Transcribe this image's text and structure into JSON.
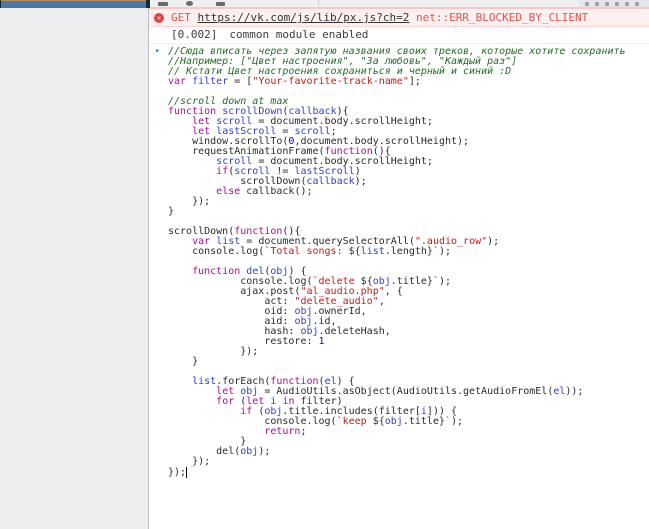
{
  "colors": {
    "vk_brand_blue": "#4a76a8",
    "error_red": "#e25252",
    "error_bg": "#fff0f0",
    "keyword_magenta": "#aa0d91",
    "variable_blue": "#3341c4",
    "string_red": "#c41a16",
    "comment_green": "#236e25",
    "input_chevron_blue": "#3b7bd9"
  },
  "console": {
    "error": {
      "icon": "circle-x-icon",
      "method": "GET",
      "url": "https://vk.com/js/lib/px.js?ch=2",
      "message": "net::ERR_BLOCKED_BY_CLIENT"
    },
    "log_row": {
      "timestamp": "[0.002]",
      "message": "common module enabled"
    },
    "input": {
      "chevron_glyph": "▸",
      "cursor_after_last_line": true,
      "lines": [
        [
          [
            "c",
            "//Сюда вписать через запятую названия своих треков, которые хотите сохранить"
          ]
        ],
        [
          [
            "c",
            "//Например: [\"Цвет настроения\", \"За любовь\", \"Каждый раз\"]"
          ]
        ],
        [
          [
            "c",
            "// Кстати Цвет настроения сохраниться и черный и синий :D"
          ]
        ],
        [
          [
            "k",
            "var"
          ],
          [
            "p",
            " "
          ],
          [
            "v",
            "filter"
          ],
          [
            "p",
            " = ["
          ],
          [
            "s",
            "\"Your-favorite-track-name\""
          ],
          [
            "p",
            "];"
          ]
        ],
        [],
        [
          [
            "c",
            "//scroll down at max"
          ]
        ],
        [
          [
            "k",
            "function"
          ],
          [
            "p",
            " "
          ],
          [
            "v",
            "scrollDown"
          ],
          [
            "p",
            "("
          ],
          [
            "v",
            "callback"
          ],
          [
            "p",
            "){"
          ]
        ],
        [
          [
            "p",
            "    "
          ],
          [
            "k",
            "let"
          ],
          [
            "p",
            " "
          ],
          [
            "v",
            "scroll"
          ],
          [
            "p",
            " = document.body.scrollHeight;"
          ]
        ],
        [
          [
            "p",
            "    "
          ],
          [
            "k",
            "let"
          ],
          [
            "p",
            " "
          ],
          [
            "v",
            "lastScroll"
          ],
          [
            "p",
            " = "
          ],
          [
            "v",
            "scroll"
          ],
          [
            "p",
            ";"
          ]
        ],
        [
          [
            "p",
            "    window.scrollTo("
          ],
          [
            "n",
            "0"
          ],
          [
            "p",
            ",document.body.scrollHeight);"
          ]
        ],
        [
          [
            "p",
            "    requestAnimationFrame("
          ],
          [
            "k",
            "function"
          ],
          [
            "p",
            "(){"
          ]
        ],
        [
          [
            "p",
            "        "
          ],
          [
            "v",
            "scroll"
          ],
          [
            "p",
            " = document.body.scrollHeight;"
          ]
        ],
        [
          [
            "p",
            "        "
          ],
          [
            "k",
            "if"
          ],
          [
            "p",
            "("
          ],
          [
            "v",
            "scroll"
          ],
          [
            "p",
            " != "
          ],
          [
            "v",
            "lastScroll"
          ],
          [
            "p",
            ")"
          ]
        ],
        [
          [
            "p",
            "            scrollDown("
          ],
          [
            "v",
            "callback"
          ],
          [
            "p",
            ");"
          ]
        ],
        [
          [
            "p",
            "        "
          ],
          [
            "k",
            "else"
          ],
          [
            "p",
            " callback();"
          ]
        ],
        [
          [
            "p",
            "    });"
          ]
        ],
        [
          [
            "p",
            "}"
          ]
        ],
        [],
        [
          [
            "p",
            "scrollDown("
          ],
          [
            "k",
            "function"
          ],
          [
            "p",
            "(){"
          ]
        ],
        [
          [
            "p",
            "    "
          ],
          [
            "k",
            "var"
          ],
          [
            "p",
            " "
          ],
          [
            "v",
            "list"
          ],
          [
            "p",
            " = document.querySelectorAll("
          ],
          [
            "s",
            "\".audio_row\""
          ],
          [
            "p",
            ");"
          ]
        ],
        [
          [
            "p",
            "    console.log("
          ],
          [
            "s",
            "`Total songs: "
          ],
          [
            "p",
            "${"
          ],
          [
            "v",
            "list"
          ],
          [
            "p",
            ".length}"
          ],
          [
            "s",
            "`"
          ],
          [
            "p",
            ");"
          ]
        ],
        [],
        [
          [
            "p",
            "    "
          ],
          [
            "k",
            "function"
          ],
          [
            "p",
            " "
          ],
          [
            "v",
            "del"
          ],
          [
            "p",
            "("
          ],
          [
            "v",
            "obj"
          ],
          [
            "p",
            ") {"
          ]
        ],
        [
          [
            "p",
            "            console.log("
          ],
          [
            "s",
            "`delete "
          ],
          [
            "p",
            "${"
          ],
          [
            "v",
            "obj"
          ],
          [
            "p",
            ".title}"
          ],
          [
            "s",
            "`"
          ],
          [
            "p",
            ");"
          ]
        ],
        [
          [
            "p",
            "            ajax.post("
          ],
          [
            "s",
            "\"al_audio.php\""
          ],
          [
            "p",
            ", {"
          ]
        ],
        [
          [
            "p",
            "                act: "
          ],
          [
            "s",
            "\"delete_audio\""
          ],
          [
            "p",
            ","
          ]
        ],
        [
          [
            "p",
            "                oid: "
          ],
          [
            "v",
            "obj"
          ],
          [
            "p",
            ".ownerId,"
          ]
        ],
        [
          [
            "p",
            "                aid: "
          ],
          [
            "v",
            "obj"
          ],
          [
            "p",
            ".id,"
          ]
        ],
        [
          [
            "p",
            "                hash: "
          ],
          [
            "v",
            "obj"
          ],
          [
            "p",
            ".deleteHash,"
          ]
        ],
        [
          [
            "p",
            "                restore: "
          ],
          [
            "n",
            "1"
          ]
        ],
        [
          [
            "p",
            "            });"
          ]
        ],
        [
          [
            "p",
            "    }"
          ]
        ],
        [],
        [
          [
            "p",
            "    "
          ],
          [
            "v",
            "list"
          ],
          [
            "p",
            ".forEach("
          ],
          [
            "k",
            "function"
          ],
          [
            "p",
            "("
          ],
          [
            "v",
            "el"
          ],
          [
            "p",
            ") {"
          ]
        ],
        [
          [
            "p",
            "        "
          ],
          [
            "k",
            "let"
          ],
          [
            "p",
            " "
          ],
          [
            "v",
            "obj"
          ],
          [
            "p",
            " = AudioUtils.asObject(AudioUtils.getAudioFromEl("
          ],
          [
            "v",
            "el"
          ],
          [
            "p",
            "));"
          ]
        ],
        [
          [
            "p",
            "        "
          ],
          [
            "k",
            "for"
          ],
          [
            "p",
            " ("
          ],
          [
            "k",
            "let"
          ],
          [
            "p",
            " "
          ],
          [
            "v",
            "i"
          ],
          [
            "p",
            " "
          ],
          [
            "k",
            "in"
          ],
          [
            "p",
            " filter)"
          ]
        ],
        [
          [
            "p",
            "            "
          ],
          [
            "k",
            "if"
          ],
          [
            "p",
            " ("
          ],
          [
            "v",
            "obj"
          ],
          [
            "p",
            ".title.includes(filter["
          ],
          [
            "v",
            "i"
          ],
          [
            "p",
            "])) {"
          ]
        ],
        [
          [
            "p",
            "                console.log("
          ],
          [
            "s",
            "`keep "
          ],
          [
            "p",
            "${"
          ],
          [
            "v",
            "obj"
          ],
          [
            "p",
            ".title}"
          ],
          [
            "s",
            "`"
          ],
          [
            "p",
            ");"
          ]
        ],
        [
          [
            "p",
            "                "
          ],
          [
            "k",
            "return"
          ],
          [
            "p",
            ";"
          ]
        ],
        [
          [
            "p",
            "            }"
          ]
        ],
        [
          [
            "p",
            "        del("
          ],
          [
            "v",
            "obj"
          ],
          [
            "p",
            ");"
          ]
        ],
        [
          [
            "p",
            "    });"
          ]
        ],
        [
          [
            "p",
            "});"
          ]
        ]
      ]
    }
  }
}
